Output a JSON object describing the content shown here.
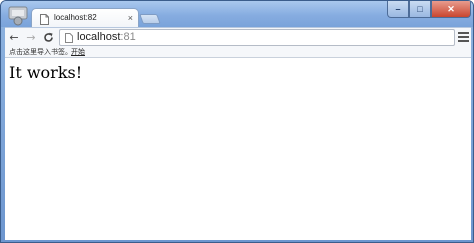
{
  "tab": {
    "title": "localhost:82",
    "close_label": "×"
  },
  "window_controls": {
    "minimize": "–",
    "maximize": "□",
    "close": "✕"
  },
  "nav": {
    "back": "←",
    "forward": "→",
    "reload": "C"
  },
  "address_bar": {
    "host": "localhost",
    "port": ":81"
  },
  "bookmarks_bar": {
    "hint": "点击这里导入书签。",
    "link": "开始"
  },
  "page": {
    "heading": "It works!"
  },
  "colors": {
    "frame": "#6d96cf",
    "tab_background": "#ffffff",
    "close_button": "#c9462f"
  }
}
